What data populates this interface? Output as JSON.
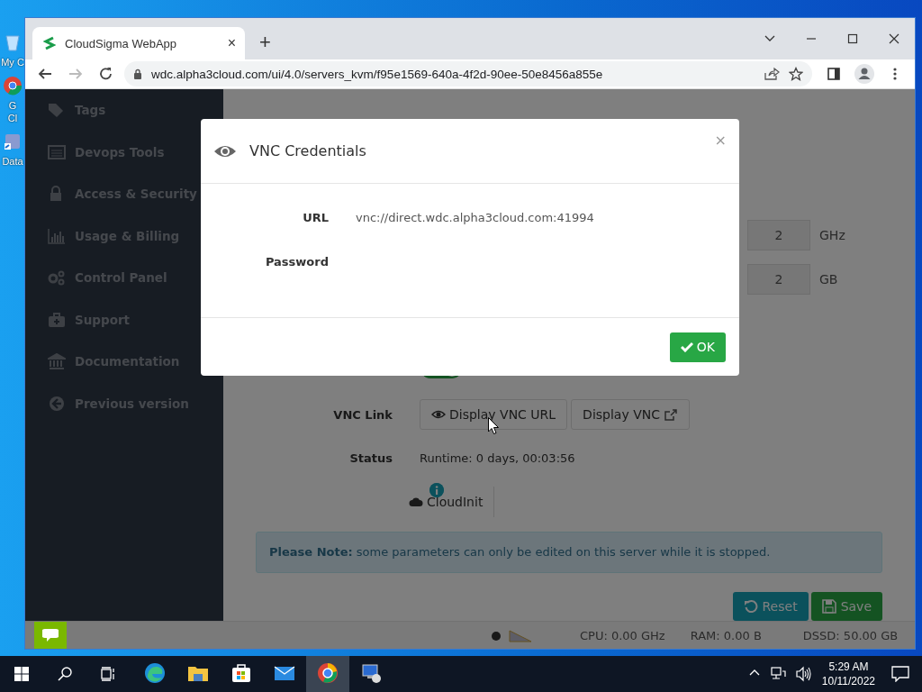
{
  "desktop": {
    "icons": [
      {
        "lines": [
          "My C"
        ]
      },
      {
        "lines": [
          "G",
          "Cl"
        ]
      },
      {
        "lines": [
          "Data"
        ]
      }
    ]
  },
  "browser": {
    "tab": {
      "title": "CloudSigma WebApp",
      "close": "×",
      "selected": true
    },
    "new_tab": "+",
    "url": "wdc.alpha3cloud.com/ui/4.0/servers_kvm/f95e1569-640a-4f2d-90ee-50e8456a855e"
  },
  "sidebar": {
    "items": [
      "Tags",
      "Devops Tools",
      "Access & Security",
      "Usage & Billing",
      "Control Panel",
      "Support",
      "Documentation",
      "Previous version"
    ]
  },
  "resources": [
    {
      "value": "2",
      "unit": "GHz"
    },
    {
      "value": "2",
      "unit": "GB"
    }
  ],
  "toggle": {
    "on": true
  },
  "vnc_link": {
    "label": "VNC Link",
    "buttons": [
      {
        "label": "Display VNC URL",
        "kind": "eye"
      },
      {
        "label": "Display VNC",
        "kind": "external"
      }
    ]
  },
  "status": {
    "label": "Status",
    "value": "Runtime: 0 days, 00:03:56"
  },
  "cloudinit": {
    "label": "CloudInit"
  },
  "note": {
    "text": "**Please Note:** some parameters can only be edited on this server while it is stopped."
  },
  "actions": [
    {
      "label": "Reset",
      "kind": "reset"
    },
    {
      "label": "Save",
      "kind": "save"
    }
  ],
  "footer": {
    "stats": [
      "CPU: 0.00 GHz",
      "RAM: 0.00 B",
      "DSSD: 50.00 GB"
    ]
  },
  "modal": {
    "title": "VNC Credentials",
    "close": "×",
    "fields": [
      {
        "label": "URL",
        "value": "vnc://direct.wdc.alpha3cloud.com:41994"
      },
      {
        "label": "Password"
      }
    ],
    "ok": "OK"
  },
  "taskbar": {
    "apps": [
      {
        "kind": "edge",
        "active": false
      },
      {
        "kind": "folder",
        "active": false
      },
      {
        "kind": "store",
        "active": false
      },
      {
        "kind": "mail",
        "active": false
      },
      {
        "kind": "chrome",
        "active": true
      },
      {
        "kind": "remote",
        "active": false
      }
    ],
    "time": "5:29 AM",
    "date": "10/11/2022"
  }
}
